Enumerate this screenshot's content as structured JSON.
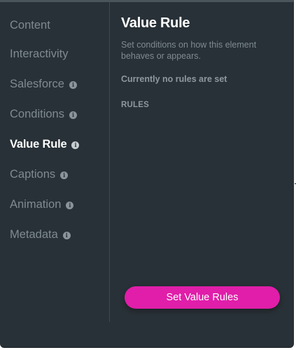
{
  "sidebar": {
    "items": [
      {
        "label": "Content",
        "has_info": false,
        "active": false
      },
      {
        "label": "Interactivity",
        "has_info": false,
        "active": false
      },
      {
        "label": "Salesforce",
        "has_info": true,
        "active": false
      },
      {
        "label": "Conditions",
        "has_info": true,
        "active": false
      },
      {
        "label": "Value Rule",
        "has_info": true,
        "active": true
      },
      {
        "label": "Captions",
        "has_info": true,
        "active": false
      },
      {
        "label": "Animation",
        "has_info": true,
        "active": false
      },
      {
        "label": "Metadata",
        "has_info": true,
        "active": false
      }
    ],
    "info_glyph": "i"
  },
  "main": {
    "title": "Value Rule",
    "description": "Set conditions on how this element behaves or appears.",
    "empty_state": "Currently no rules are set",
    "rules_heading": "RULES",
    "primary_button": "Set Value Rules"
  },
  "colors": {
    "panel_background": "#283137",
    "accent_button": "#e01ea9",
    "active_text": "#ffffff",
    "muted_text": "#7f8a91"
  }
}
